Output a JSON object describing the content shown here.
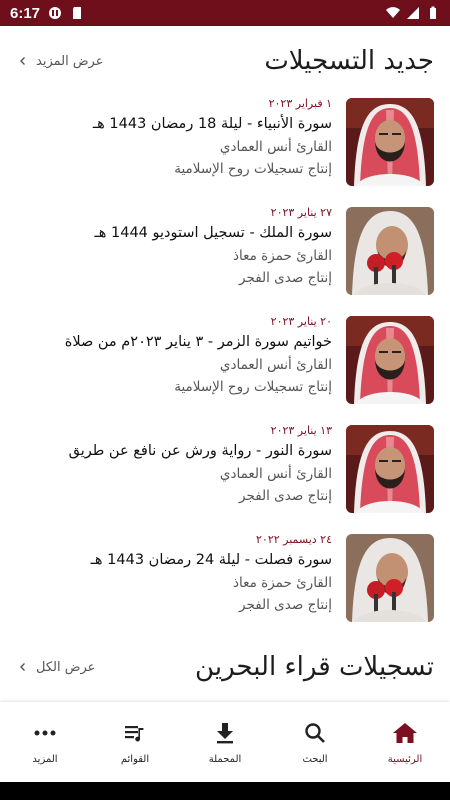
{
  "status_bar": {
    "time": "6:17"
  },
  "colors": {
    "brand": "#6e0f1b",
    "accent": "#7a1020"
  },
  "section_new": {
    "title": "جديد التسجيلات",
    "link": "عرض المزيد"
  },
  "section_bahrain": {
    "title": "تسجيلات قراء البحرين",
    "link": "عرض الكل"
  },
  "recordings": [
    {
      "date": "١ فبراير ٢٠٢٣",
      "title": "سورة الأنبياء -  ليلة 18 رمضان 1443 هـ",
      "reader": "القارئ أنس العمادي",
      "producer": "إنتاج تسجيلات روح الإسلامية",
      "thumb": "reader-portrait"
    },
    {
      "date": "٢٧ يناير ٢٠٢٣",
      "title": "سورة الملك -  تسجيل استوديو 1444 هـ",
      "reader": "القارئ حمزة معاذ",
      "producer": "إنتاج صدى الفجر",
      "thumb": "reader-microphone"
    },
    {
      "date": "٢٠ يناير ٢٠٢٣",
      "title": "خواتيم سورة الزمر -  ٣ يناير ٢٠٢٣م من صلاة",
      "reader": "القارئ أنس العمادي",
      "producer": "إنتاج تسجيلات روح الإسلامية",
      "thumb": "reader-portrait"
    },
    {
      "date": "١٣ يناير ٢٠٢٣",
      "title": "سورة النور -  رواية ورش عن نافع عن طريق",
      "reader": "القارئ أنس العمادي",
      "producer": "إنتاج صدى الفجر",
      "thumb": "reader-portrait"
    },
    {
      "date": "٢٤ ديسمبر ٢٠٢٢",
      "title": "سورة فصلت -  ليلة 24 رمضان 1443 هـ",
      "reader": "القارئ حمزة معاذ",
      "producer": "إنتاج صدى الفجر",
      "thumb": "reader-microphone"
    }
  ],
  "bottom_nav": [
    {
      "label": "الرئيسية",
      "icon": "home-icon",
      "active": true
    },
    {
      "label": "البحث",
      "icon": "search-icon",
      "active": false
    },
    {
      "label": "المحملة",
      "icon": "download-icon",
      "active": false
    },
    {
      "label": "القوائم",
      "icon": "playlist-icon",
      "active": false
    },
    {
      "label": "المزيد",
      "icon": "more-icon",
      "active": false
    }
  ]
}
